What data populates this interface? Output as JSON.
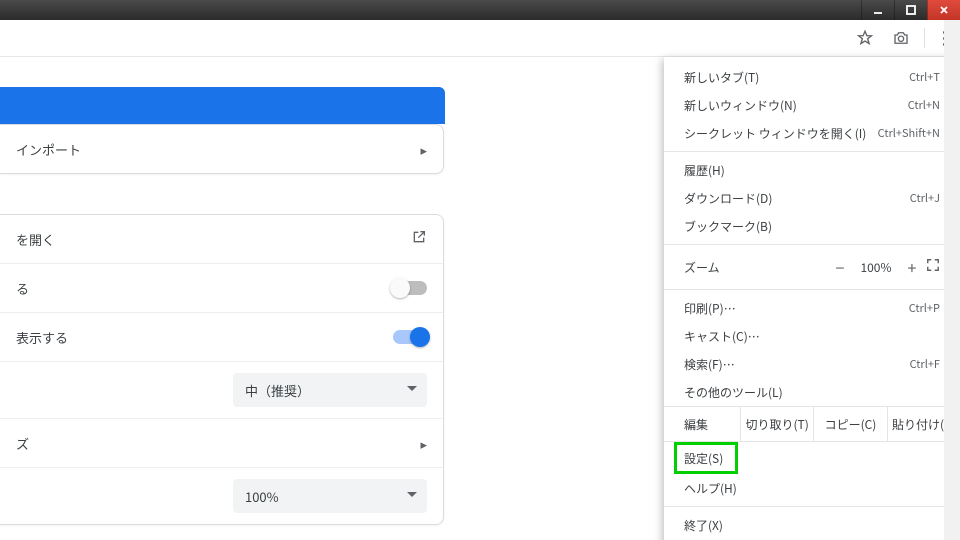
{
  "window_controls": {
    "minimize": "minimize",
    "maximize": "maximize",
    "close": "close"
  },
  "toolbar": {
    "star": "bookmark-star",
    "camera": "screenshot",
    "menu": "customize-and-control"
  },
  "settings": {
    "import_row": "インポート",
    "open_row": "を開く",
    "toggle1_label": "る",
    "toggle2_label": "表示する",
    "select1_label": "",
    "select1_value": "中（推奨）",
    "size_row_label": "ズ",
    "select2_label": "",
    "select2_value": "100%"
  },
  "menu": {
    "new_tab": {
      "label": "新しいタブ(T)",
      "shortcut": "Ctrl+T"
    },
    "new_window": {
      "label": "新しいウィンドウ(N)",
      "shortcut": "Ctrl+N"
    },
    "incognito": {
      "label": "シークレット ウィンドウを開く(I)",
      "shortcut": "Ctrl+Shift+N"
    },
    "history": {
      "label": "履歴(H)"
    },
    "downloads": {
      "label": "ダウンロード(D)",
      "shortcut": "Ctrl+J"
    },
    "bookmarks": {
      "label": "ブックマーク(B)"
    },
    "zoom_label": "ズーム",
    "zoom_value": "100%",
    "print": {
      "label": "印刷(P)…",
      "shortcut": "Ctrl+P"
    },
    "cast": {
      "label": "キャスト(C)…"
    },
    "find": {
      "label": "検索(F)…",
      "shortcut": "Ctrl+F"
    },
    "more_tools": {
      "label": "その他のツール(L)"
    },
    "edit": {
      "label": "編集",
      "cut": "切り取り(T)",
      "copy": "コピー(C)",
      "paste": "貼り付け(P)"
    },
    "settings": {
      "label": "設定(S)"
    },
    "help": {
      "label": "ヘルプ(H)"
    },
    "exit": {
      "label": "終了(X)"
    }
  }
}
